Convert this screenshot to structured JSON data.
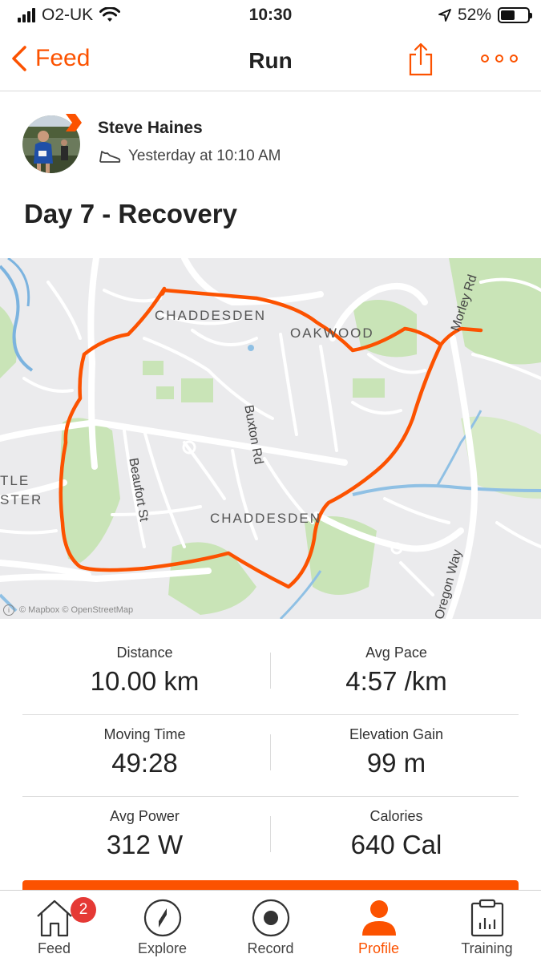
{
  "status_bar": {
    "carrier": "O2-UK",
    "time": "10:30",
    "battery": "52%",
    "battery_level": 0.52,
    "icons": [
      "signal-icon",
      "wifi-icon",
      "location-arrow-icon",
      "battery-icon"
    ]
  },
  "nav": {
    "back_label": "Feed",
    "title": "Run"
  },
  "athlete": {
    "name": "Steve Haines",
    "timestamp": "Yesterday at 10:10 AM"
  },
  "activity": {
    "title": "Day 7 - Recovery"
  },
  "map": {
    "labels": {
      "chaddesden_north": "CHADDESDEN",
      "oakwood": "OAKWOOD",
      "chaddesden_south": "CHADDESDEN",
      "castle_partial_1": "TLE",
      "castle_partial_2": "STER",
      "buxton_rd": "Buxton Rd",
      "beaufort_st": "Beaufort St",
      "morley_rd": "Morley Rd",
      "oregon_way": "Oregon Way"
    },
    "attribution": "© Mapbox © OpenStreetMap",
    "route_color": "#fc5200"
  },
  "stats": {
    "distance_label": "Distance",
    "distance_value": "10.00 km",
    "pace_label": "Avg Pace",
    "pace_value": "4:57 /km",
    "moving_time_label": "Moving Time",
    "moving_time_value": "49:28",
    "elevation_label": "Elevation Gain",
    "elevation_value": "99 m",
    "power_label": "Avg Power",
    "power_value": "312 W",
    "calories_label": "Calories",
    "calories_value": "640 Cal"
  },
  "tabs": [
    {
      "label": "Feed",
      "badge": "2",
      "active": false
    },
    {
      "label": "Explore",
      "active": false
    },
    {
      "label": "Record",
      "active": false
    },
    {
      "label": "Profile",
      "active": true
    },
    {
      "label": "Training",
      "active": false
    }
  ],
  "colors": {
    "accent": "#fc5200",
    "badge": "#e53935"
  }
}
